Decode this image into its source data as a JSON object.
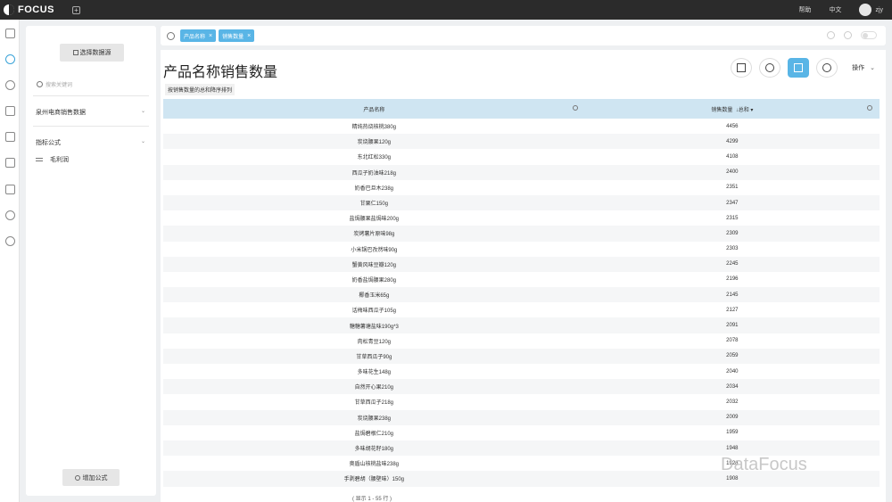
{
  "app": {
    "logo_text": "FOCUS"
  },
  "topbar": {
    "help": "帮助",
    "lang": "中文",
    "user": "zjy"
  },
  "leftnav": {
    "icons": [
      "home-icon",
      "search-icon",
      "help-icon",
      "dashboard-icon",
      "table-icon",
      "folder-icon",
      "dataset-icon",
      "user-icon",
      "settings-icon"
    ]
  },
  "panel": {
    "datasource_button": "选择数据源",
    "search_placeholder": "搜索关键词",
    "group_title": "泉州电商销售数据",
    "formula_title": "指标公式",
    "formula_item": "毛利润",
    "add_formula_button": "增加公式"
  },
  "searchbar": {
    "chips": [
      "产品名称",
      "销售数量"
    ]
  },
  "result": {
    "title": "产品名称销售数量",
    "subtitle": "按销售数量的总和降序排列",
    "ops_label": "操作",
    "col1_header": "产品名称",
    "col2_header": "销售数量",
    "col2_agg": "总和",
    "sort_indicator": "↓",
    "footer": "( 显示 1 - 55 行 )",
    "rows": [
      [
        "精纯热烧核桃380g",
        "4456"
      ],
      [
        "炭烧腰果120g",
        "4299"
      ],
      [
        "东北红松330g",
        "4108"
      ],
      [
        "西瓜子奶油味218g",
        "2400"
      ],
      [
        "奶香巴旦木238g",
        "2351"
      ],
      [
        "甘栗仁150g",
        "2347"
      ],
      [
        "盐焗腰果盐焗味200g",
        "2315"
      ],
      [
        "炭烤薯片原味98g",
        "2309"
      ],
      [
        "小米锅巴孜然味90g",
        "2303"
      ],
      [
        "蟹黄风味豆瓣120g",
        "2245"
      ],
      [
        "奶香盐焗腰果280g",
        "2196"
      ],
      [
        "椰香玉米65g",
        "2145"
      ],
      [
        "话梅味西瓜子105g",
        "2127"
      ],
      [
        "糖糖薯塘盐味190g*3",
        "2091"
      ],
      [
        "肉松青豆120g",
        "2078"
      ],
      [
        "甘草西瓜子90g",
        "2059"
      ],
      [
        "多味花生148g",
        "2040"
      ],
      [
        "自然开心果210g",
        "2034"
      ],
      [
        "甘草西瓜子218g",
        "2032"
      ],
      [
        "炭烧腰果238g",
        "2009"
      ],
      [
        "盐焗碧根仁210g",
        "1959"
      ],
      [
        "多味胡花籽180g",
        "1948"
      ],
      [
        "奥盾山核桃盐味238g",
        "1928"
      ],
      [
        "手剥碧胡（腰壁味）150g",
        "1908"
      ]
    ]
  },
  "watermark": "DataFocus"
}
